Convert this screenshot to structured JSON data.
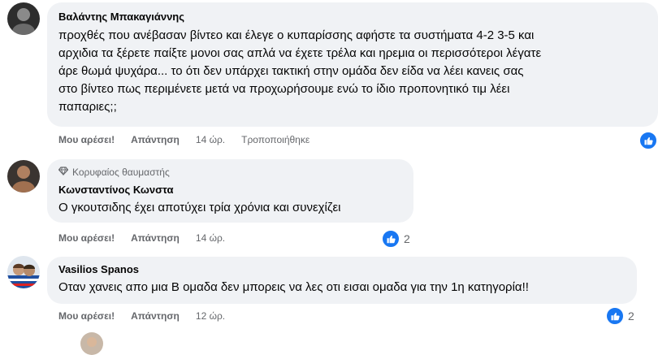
{
  "comments": [
    {
      "author": "Βαλάντης Μπακαγιάννης",
      "text_lines": [
        "προχθές που ανέβασαν βίντεο και έλεγε ο κυπαρίσσης αφήστε τα συστήματα 4-2 3-5 και",
        "αρχιδια τα ξέρετε παίξτε μονοι σας απλά να έχετε τρέλα και ηρεμια οι περισσότεροι λέγατε",
        "άρε θωμά ψυχάρα... το ότι δεν υπάρχει τακτική στην ομάδα δεν είδα να λέει κανεις σας",
        "στο βίντεο πως περιμένετε μετά να προχωρήσουμε ενώ το ίδιο προπονητικό τιμ λέει",
        "παπαριες;;"
      ],
      "like": "Μου αρέσει!",
      "reply": "Απάντηση",
      "time": "14 ώρ.",
      "edited": "Τροποποιήθηκε",
      "reaction_count": ""
    },
    {
      "badge": "Κορυφαίος θαυμαστής",
      "author": "Κωνσταντίνος Κωνστα",
      "text": "Ο γκουτσιδης έχει αποτύχει τρία χρόνια και συνεχίζει",
      "like": "Μου αρέσει!",
      "reply": "Απάντηση",
      "time": "14 ώρ.",
      "reaction_count": "2"
    },
    {
      "author": "Vasilios Spanos",
      "text": "Οταν χανεις απο μια Β ομαδα δεν μπορεις να λες οτι εισαι ομαδα για την 1η κατηγορία!!",
      "like": "Μου αρέσει!",
      "reply": "Απάντηση",
      "time": "12 ώρ.",
      "reaction_count": "2"
    }
  ],
  "colors": {
    "bubble": "#f0f2f5",
    "secondary_text": "#65676b",
    "like_blue": "#1877f2"
  },
  "icons": [
    "diamond-icon",
    "thumbs-up-icon"
  ]
}
